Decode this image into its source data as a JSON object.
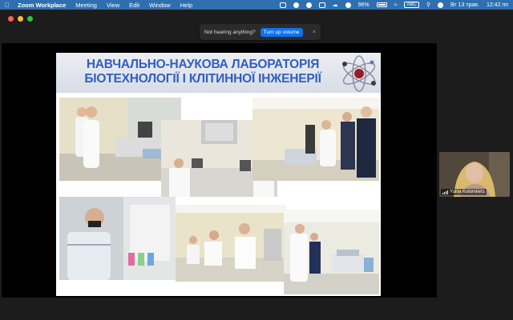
{
  "menubar": {
    "app_name": "Zoom Workplace",
    "menus": [
      "Meeting",
      "View",
      "Edit",
      "Window",
      "Help"
    ],
    "battery": "96%",
    "input_source": "ABC",
    "date": "Вт 13 трав.",
    "time": "12:42 пп"
  },
  "notification": {
    "text": "Not hearing anything?",
    "button": "Turn up volume",
    "close": "×"
  },
  "slide": {
    "title_line1": "НАВЧАЛЬНО-НАУКОВА ЛАБОРАТОРІЯ",
    "title_line2": "БІОТЕХНОЛОГІЇ І КЛІТИННОЇ ІНЖЕНЕРІЇ"
  },
  "participant": {
    "name": "Yuliia Kolomiiets"
  },
  "colors": {
    "menubar": "#2f6fb0",
    "title_blue": "#2f5fbf",
    "zoom_blue": "#0e72ed"
  }
}
